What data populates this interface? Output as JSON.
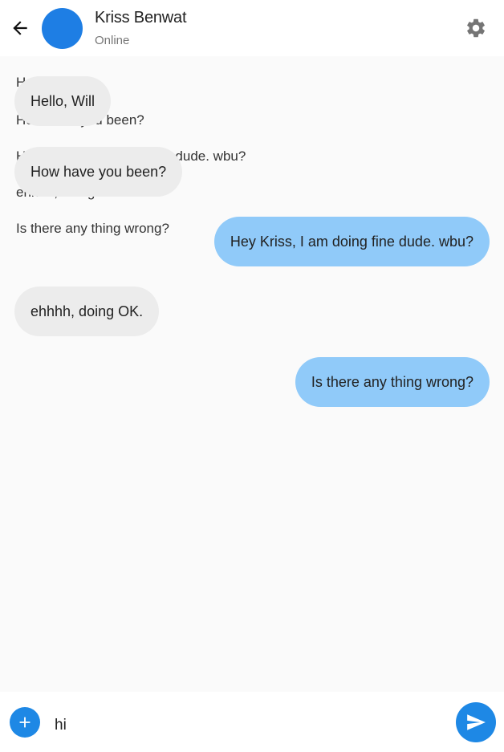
{
  "header": {
    "contact_name": "Kriss Benwat",
    "contact_status": "Online",
    "avatar_color": "#1e7ee4"
  },
  "icons": {
    "back": "arrow-left-icon",
    "settings": "gear-icon",
    "add": "plus-icon",
    "send": "send-icon"
  },
  "ghost_lines": [
    "H",
    "How have you been?",
    "Hey Kriss, I am doing fine dude. wbu?",
    "ehhhh, doing OK.",
    "Is there any thing wrong?"
  ],
  "messages": [
    {
      "direction": "incoming",
      "text": "Hello, Will"
    },
    {
      "direction": "incoming",
      "text": "How have you been?"
    },
    {
      "direction": "outgoing",
      "text": "Hey Kriss, I am doing fine dude. wbu?"
    },
    {
      "direction": "incoming",
      "text": "ehhhh, doing OK."
    },
    {
      "direction": "outgoing",
      "text": "Is there any thing wrong?"
    }
  ],
  "composer": {
    "value": "hi",
    "placeholder": ""
  },
  "colors": {
    "incoming_bubble": "#ececec",
    "outgoing_bubble": "#90caf9",
    "accent": "#1e88e5"
  }
}
